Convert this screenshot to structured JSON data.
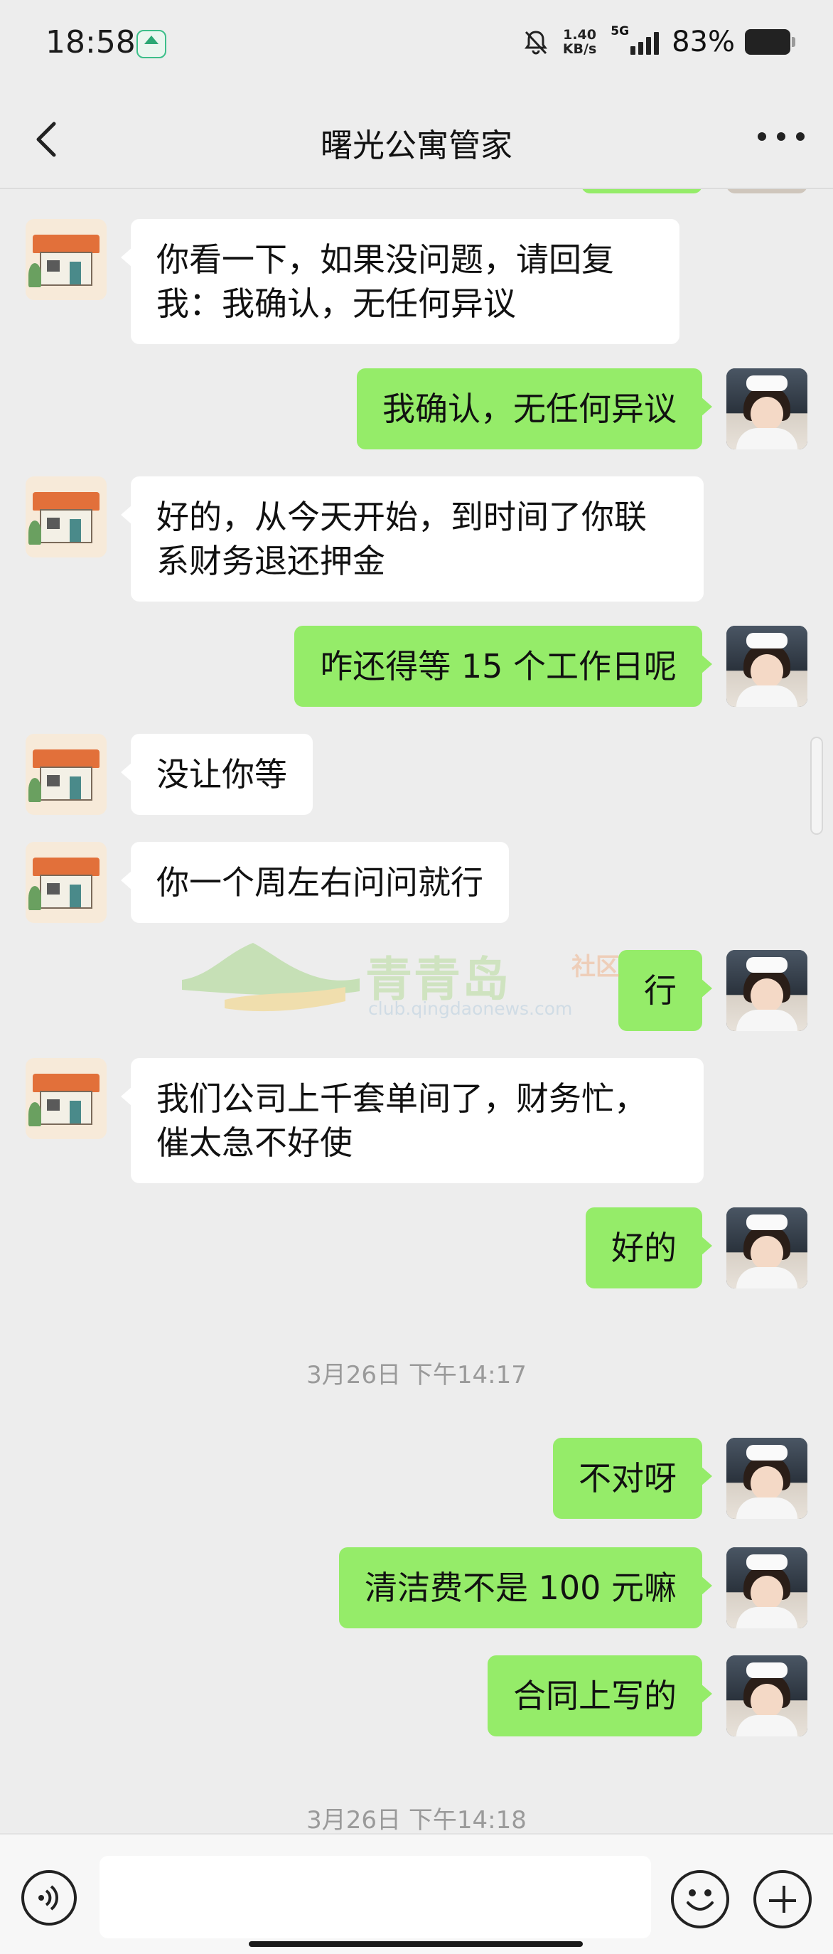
{
  "status_bar": {
    "time": "18:58",
    "net_speed_value": "1.40",
    "net_speed_unit": "KB/s",
    "network": "5G",
    "battery": "83%",
    "icons": [
      "app-notification-icon",
      "mute-icon",
      "signal-icon",
      "battery-icon"
    ]
  },
  "nav": {
    "title": "曙光公寓管家",
    "back_icon": "chevron-left-icon",
    "more_icon": "more-icon"
  },
  "messages": [
    {
      "side": "left",
      "text": "你看一下，如果没问题，请回复\n我：我确认，无任何异议"
    },
    {
      "side": "right",
      "text": "我确认，无任何异议"
    },
    {
      "side": "left",
      "text": "好的，从今天开始，到时间了你联\n系财务退还押金"
    },
    {
      "side": "right",
      "text": "咋还得等 15 个工作日呢"
    },
    {
      "side": "left",
      "text": "没让你等"
    },
    {
      "side": "left",
      "text": "你一个周左右问问就行"
    },
    {
      "side": "right",
      "text": "行"
    },
    {
      "side": "left",
      "text": "我们公司上千套单间了，财务忙，\n催太急不好使"
    },
    {
      "side": "right",
      "text": "好的"
    },
    {
      "side": "right",
      "text": "不对呀"
    },
    {
      "side": "right",
      "text": "清洁费不是 100 元嘛"
    },
    {
      "side": "right",
      "text": "合同上写的"
    }
  ],
  "timestamps": [
    "3月26日 下午14:17",
    "3月26日 下午14:18"
  ],
  "watermark": {
    "title": "青青岛",
    "suffix": "社区",
    "url": "club.qingdaonews.com"
  },
  "input_bar": {
    "icons": [
      "voice-icon",
      "emoji-icon",
      "plus-icon"
    ]
  },
  "colors": {
    "background": "#ededed",
    "bubble_self": "#95ec69",
    "bubble_other": "#ffffff",
    "timestamp": "#9a9a9a"
  }
}
